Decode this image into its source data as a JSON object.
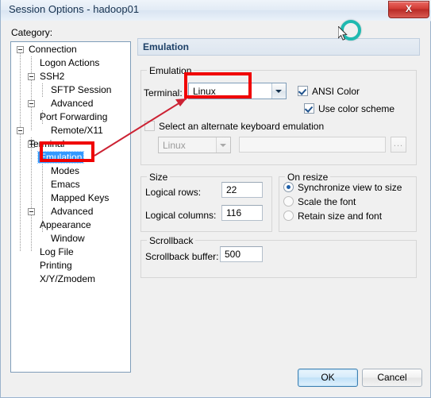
{
  "window": {
    "title": "Session Options - hadoop01",
    "close_label": "X"
  },
  "sidebar": {
    "label": "Category:",
    "selected": "Emulation",
    "items": [
      {
        "label": "Connection",
        "level": 0,
        "expander": true
      },
      {
        "label": "Logon Actions",
        "level": 1,
        "expander": false
      },
      {
        "label": "SSH2",
        "level": 1,
        "expander": true
      },
      {
        "label": "SFTP Session",
        "level": 2,
        "expander": false
      },
      {
        "label": "Advanced",
        "level": 2,
        "expander": false
      },
      {
        "label": "Port Forwarding",
        "level": 1,
        "expander": true
      },
      {
        "label": "Remote/X11",
        "level": 2,
        "expander": false
      },
      {
        "label": "Terminal",
        "level": 0,
        "expander": true
      },
      {
        "label": "Emulation",
        "level": 1,
        "expander": true
      },
      {
        "label": "Modes",
        "level": 2,
        "expander": false
      },
      {
        "label": "Emacs",
        "level": 2,
        "expander": false
      },
      {
        "label": "Mapped Keys",
        "level": 2,
        "expander": false
      },
      {
        "label": "Advanced",
        "level": 2,
        "expander": false
      },
      {
        "label": "Appearance",
        "level": 1,
        "expander": true
      },
      {
        "label": "Window",
        "level": 2,
        "expander": false
      },
      {
        "label": "Log File",
        "level": 1,
        "expander": false
      },
      {
        "label": "Printing",
        "level": 1,
        "expander": false
      },
      {
        "label": "X/Y/Zmodem",
        "level": 1,
        "expander": false
      }
    ]
  },
  "panel": {
    "header": "Emulation",
    "emulation": {
      "group_title": "Emulation",
      "terminal_label": "Terminal:",
      "terminal_value": "Linux",
      "ansi_color_label": "ANSI Color",
      "ansi_color_checked": true,
      "use_color_scheme_label": "Use color scheme",
      "use_color_scheme_checked": true,
      "alt_keyboard_label": "Select an alternate keyboard emulation",
      "alt_keyboard_checked": false,
      "alt_keyboard_value": "Linux",
      "alt_keyboard_path": "",
      "browse_label": "..."
    },
    "size": {
      "group_title": "Size",
      "rows_label": "Logical rows:",
      "rows_value": "22",
      "cols_label": "Logical columns:",
      "cols_value": "116"
    },
    "on_resize": {
      "group_title": "On resize",
      "options": [
        {
          "label": "Synchronize view to size",
          "selected": true
        },
        {
          "label": "Scale the font",
          "selected": false
        },
        {
          "label": "Retain size and font",
          "selected": false
        }
      ]
    },
    "scrollback": {
      "group_title": "Scrollback",
      "buffer_label": "Scrollback buffer:",
      "buffer_value": "500"
    }
  },
  "footer": {
    "ok_label": "OK",
    "cancel_label": "Cancel"
  },
  "annotations": {
    "accent_color": "#f00000",
    "boxes": [
      "emulation-tree-node",
      "terminal-combo"
    ],
    "arrow": "emulation-node-to-terminal-combo"
  },
  "overlay": {
    "spinner": "busy-spinner",
    "cursor": "mouse-pointer"
  },
  "colors": {
    "selection_blue": "#3399ff",
    "annotation_red": "#f00000",
    "spinner_teal": "#1fb9b0",
    "header_text": "#1c3f66"
  }
}
